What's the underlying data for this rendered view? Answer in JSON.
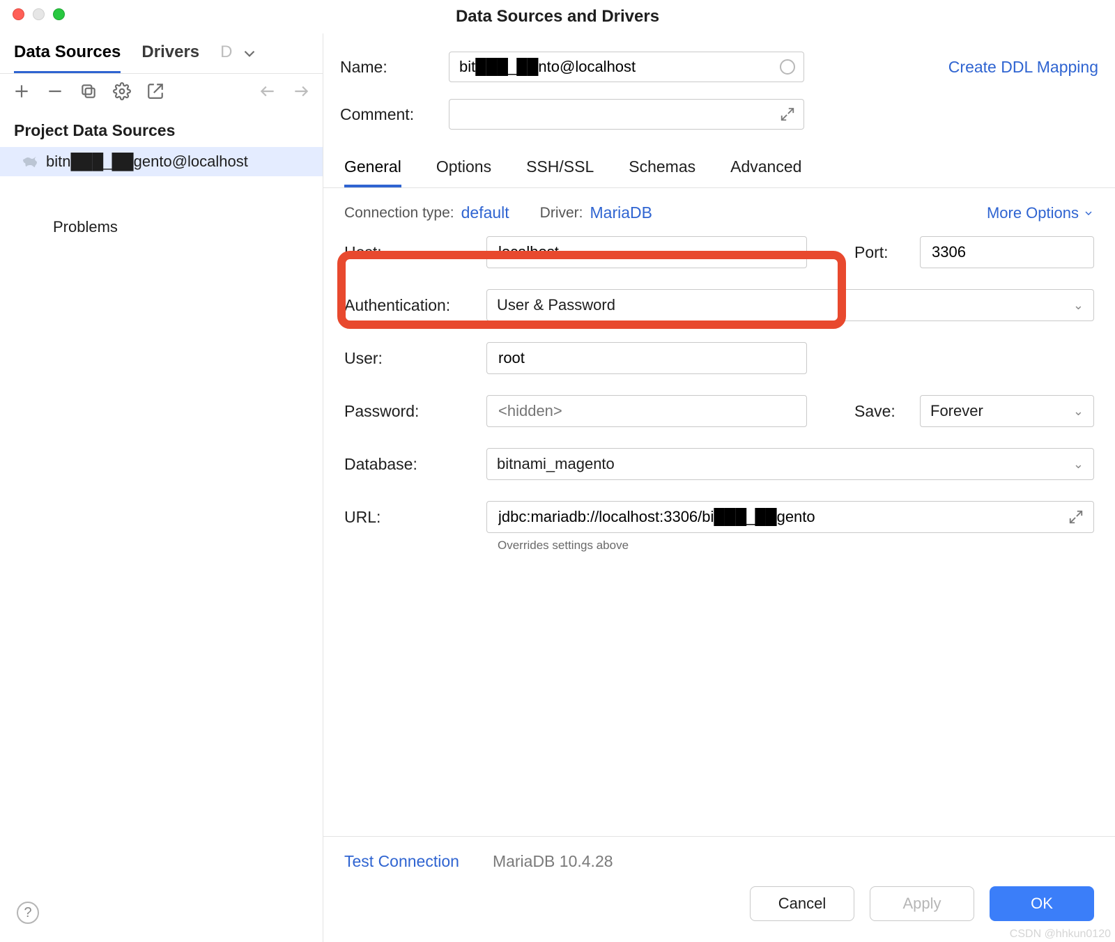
{
  "title": "Data Sources and Drivers",
  "sidebar": {
    "tabs": [
      "Data Sources",
      "Drivers",
      "D"
    ],
    "section_label": "Project Data Sources",
    "datasource": "bitn███_██gento@localhost",
    "problems": "Problems"
  },
  "header": {
    "name_label": "Name:",
    "name_value": "bit███_██nto@localhost",
    "comment_label": "Comment:",
    "ddl_link": "Create DDL Mapping"
  },
  "tabs": [
    "General",
    "Options",
    "SSH/SSL",
    "Schemas",
    "Advanced"
  ],
  "conn": {
    "type_label": "Connection type:",
    "type_value": "default",
    "driver_label": "Driver:",
    "driver_value": "MariaDB",
    "more": "More Options"
  },
  "fields": {
    "host_label": "Host:",
    "host_value": "localhost",
    "port_label": "Port:",
    "port_value": "3306",
    "auth_label": "Authentication:",
    "auth_value": "User & Password",
    "user_label": "User:",
    "user_value": "root",
    "pass_label": "Password:",
    "pass_placeholder": "<hidden>",
    "save_label": "Save:",
    "save_value": "Forever",
    "db_label": "Database:",
    "db_value": "bitnami_magento",
    "url_label": "URL:",
    "url_value": "jdbc:mariadb://localhost:3306/bi███_██gento",
    "url_note": "Overrides settings above"
  },
  "footer": {
    "test": "Test Connection",
    "driver_version": "MariaDB 10.4.28",
    "cancel": "Cancel",
    "apply": "Apply",
    "ok": "OK"
  },
  "watermark": "CSDN @hhkun0120"
}
